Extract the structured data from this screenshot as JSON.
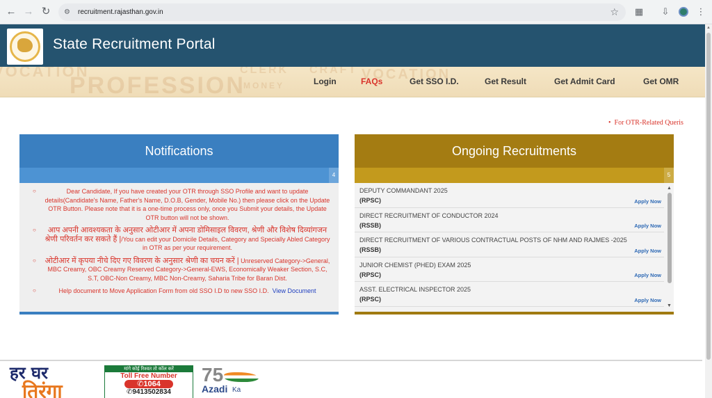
{
  "browser": {
    "url": "recruitment.rajasthan.gov.in"
  },
  "site": {
    "title": "State Recruitment Portal"
  },
  "menu": {
    "background_words": [
      "VOCATION",
      "PROFESSION",
      "CLERK",
      "MONEY",
      "CRAFT",
      "VOCATION"
    ],
    "items": [
      {
        "label": "Login"
      },
      {
        "label": "FAQs"
      },
      {
        "label": "Get SSO I.D."
      },
      {
        "label": "Get Result"
      },
      {
        "label": "Get Admit Card"
      },
      {
        "label": "Get OMR"
      }
    ]
  },
  "otr_note": "For OTR-Related Queris",
  "notifications": {
    "title": "Notifications",
    "count": "4",
    "items": [
      {
        "text": "Dear Candidate, If you have created your OTR through SSO Profile and want to update details(Candidate's Name, Father's Name, D.O.B, Gender, Mobile No.) then please click on the Update OTR Button. Please note that it is a one-time process only, once you Submit your details, the Update OTR button will not be shown."
      },
      {
        "hindi": "आप अपनी आवश्यकता के अनुसार ओटीआर में अपना डोमिसाइल विवरण, श्रेणी और विशेष दिव्यांगजन श्रेणी परिवर्तन कर सकते हैं |",
        "text": "/You can edit your Domicile Details, Category and Specially Abled Category in OTR as per your requirement."
      },
      {
        "hindi": "ओटीआर में कृपया नीचे दिए गए विवरण के अनुसार श्रेणी का चयन करें |",
        "text": " Unreserved Category->General, MBC Creamy, OBC Creamy Reserved Category->General-EWS, Economically Weaker Section, S.C, S.T, OBC-Non Creamy, MBC Non-Creamy, Saharia Tribe for Baran Dist."
      },
      {
        "text": "Help document to Move Application Form from old SSO I.D to new SSO I.D.",
        "link": "View Document"
      }
    ]
  },
  "recruitments": {
    "title": "Ongoing Recruitments",
    "count": "5",
    "apply_label": "Apply Now",
    "items": [
      {
        "post": "DEPUTY COMMANDANT 2025",
        "org": "(RPSC)"
      },
      {
        "post": "DIRECT RECRUITMENT OF CONDUCTOR 2024",
        "org": "(RSSB)"
      },
      {
        "post": "DIRECT RECRUITMENT OF VARIOUS CONTRACTUAL POSTS OF NHM AND RAJMES -2025",
        "org": "(RSSB)"
      },
      {
        "post": "JUNIOR CHEMIST (PHED) EXAM 2025",
        "org": "(RPSC)"
      },
      {
        "post": "ASST. ELECTRICAL INSPECTOR 2025",
        "org": "(RPSC)"
      }
    ]
  },
  "footer": {
    "tiranga_line1": "हर घर",
    "tiranga_line2": "तिरंगा",
    "tollfree_top": "मांगे कोई रिश्वत तो कॉल करें",
    "tollfree_label": "Toll Free Number",
    "tollfree_number": "1064",
    "tollfree_phone": "9413502834",
    "azadi_num": "75",
    "azadi_word": "Azadi",
    "azadi_ka": "Ka"
  }
}
